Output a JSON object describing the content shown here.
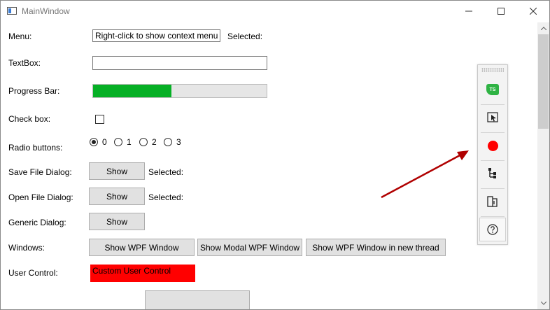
{
  "window": {
    "title": "MainWindow"
  },
  "form": {
    "menu_label": "Menu:",
    "menu_field_text": "Right-click to show context menu",
    "menu_selected_label": "Selected:",
    "textbox_label": "TextBox:",
    "textbox_value": "",
    "progress_label": "Progress Bar:",
    "progress_fraction": 0.45,
    "checkbox_label": "Check box:",
    "checkbox_checked": false,
    "radio_label": "Radio buttons:",
    "radio_options": [
      "0",
      "1",
      "2",
      "3"
    ],
    "radio_selected": "0",
    "save_dialog_label": "Save File Dialog:",
    "save_dialog_button": "Show",
    "save_dialog_selected": "Selected:",
    "open_dialog_label": "Open File Dialog:",
    "open_dialog_button": "Show",
    "open_dialog_selected": "Selected:",
    "generic_dialog_label": "Generic Dialog:",
    "generic_dialog_button": "Show",
    "windows_label": "Windows:",
    "windows_buttons": [
      "Show WPF Window",
      "Show Modal WPF Window",
      "Show WPF Window in new thread"
    ],
    "user_control_label": "User Control:",
    "user_control_text": "Custom User Control",
    "user_control_color": "#ff0000"
  },
  "toolbar": {
    "badge_text": "TS",
    "badge_color": "#2fb344",
    "record_color": "#ff0000",
    "arrow_color": "#b00000",
    "icons": [
      "testsmart-logo-icon",
      "select-element-icon",
      "record-icon",
      "tree-view-icon",
      "dock-panel-icon",
      "help-icon"
    ]
  },
  "colors": {
    "progress_fill": "#06b025",
    "progress_track": "#e6e6e6",
    "button_face": "#e1e1e1"
  }
}
